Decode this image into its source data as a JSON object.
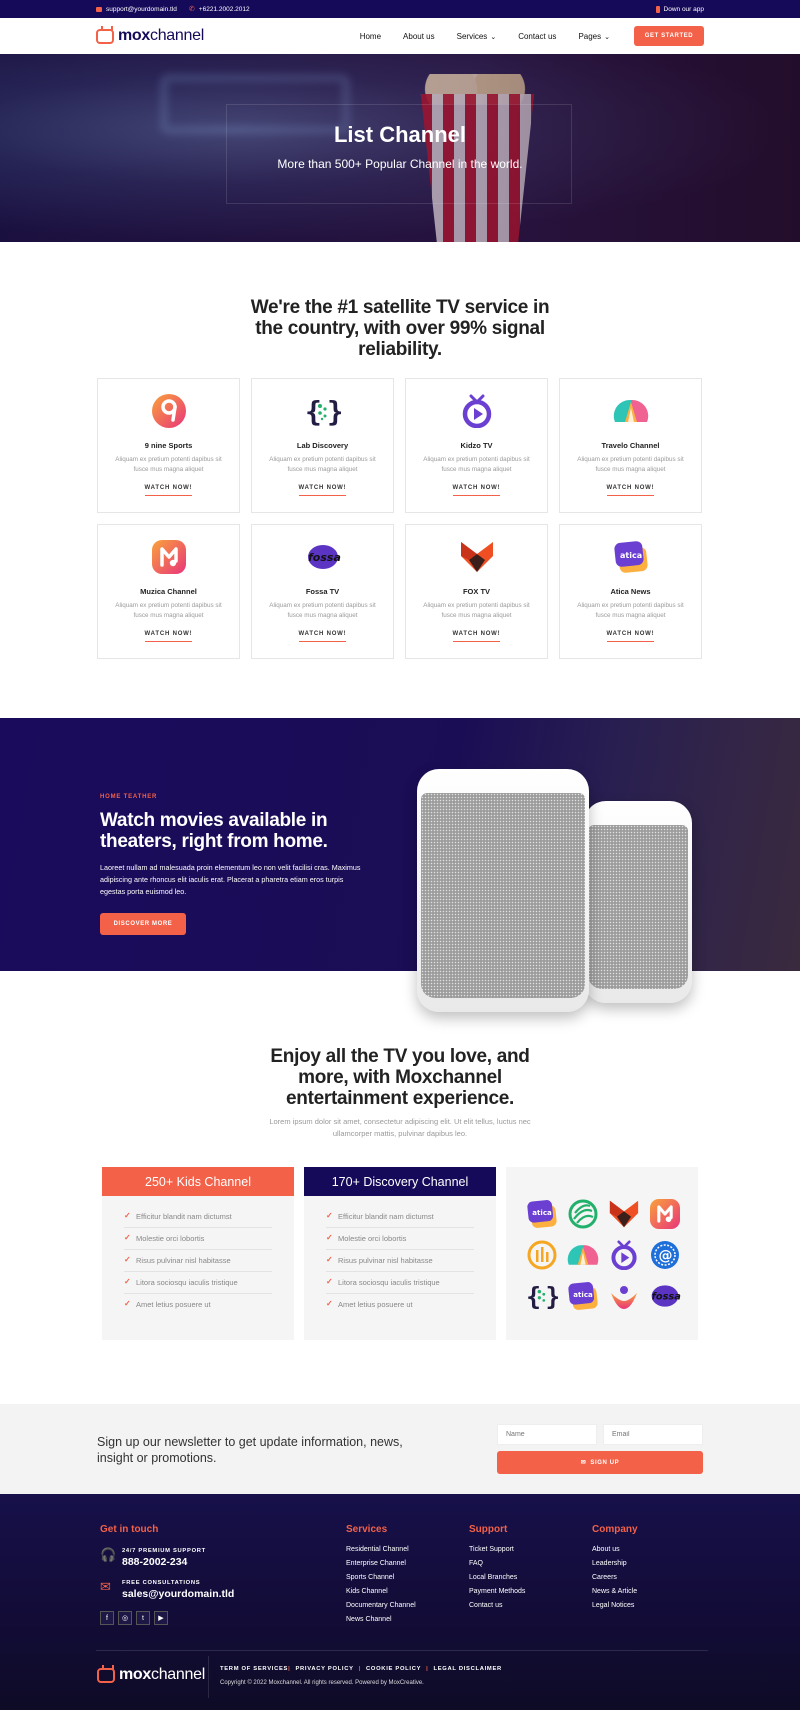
{
  "topbar": {
    "email": "support@yourdomain.tld",
    "phone": "+6221.2002.2012",
    "app_link": "Down our app"
  },
  "brand": {
    "name_bold": "mox",
    "name_regular": "channel"
  },
  "nav": {
    "items": [
      "Home",
      "About us",
      "Services",
      "Contact us",
      "Pages"
    ],
    "cta": "GET STARTED"
  },
  "hero": {
    "title": "List Channel",
    "subtitle": "More than 500+ Popular Channel in the world."
  },
  "channels_section": {
    "title": "We're the #1 satellite TV service in the country, with over 99% signal reliability.",
    "cards": [
      {
        "name": "9 nine Sports",
        "desc": "Aliquam ex pretium potenti dapibus sit fusce mus magna aliquet",
        "cta": "WATCH NOW!",
        "icon": "nine-sports-icon"
      },
      {
        "name": "Lab Discovery",
        "desc": "Aliquam ex pretium potenti dapibus sit fusce mus magna aliquet",
        "cta": "WATCH NOW!",
        "icon": "lab-discovery-icon"
      },
      {
        "name": "Kidzo TV",
        "desc": "Aliquam ex pretium potenti dapibus sit fusce mus magna aliquet",
        "cta": "WATCH NOW!",
        "icon": "kidzo-tv-icon"
      },
      {
        "name": "Travelo Channel",
        "desc": "Aliquam ex pretium potenti dapibus sit fusce mus magna aliquet",
        "cta": "WATCH NOW!",
        "icon": "travelo-icon"
      },
      {
        "name": "Muzica Channel",
        "desc": "Aliquam ex pretium potenti dapibus sit fusce mus magna aliquet",
        "cta": "WATCH NOW!",
        "icon": "muzica-icon"
      },
      {
        "name": "Fossa TV",
        "desc": "Aliquam ex pretium potenti dapibus sit fusce mus magna aliquet",
        "cta": "WATCH NOW!",
        "icon": "fossa-icon"
      },
      {
        "name": "FOX TV",
        "desc": "Aliquam ex pretium potenti dapibus sit fusce mus magna aliquet",
        "cta": "WATCH NOW!",
        "icon": "fox-icon"
      },
      {
        "name": "Atica News",
        "desc": "Aliquam ex pretium potenti dapibus sit fusce mus magna aliquet",
        "cta": "WATCH NOW!",
        "icon": "atica-icon"
      }
    ],
    "fossa_logo_text": "fossa",
    "atica_logo_text": "atica"
  },
  "theater": {
    "eyebrow": "HOME TEATHER",
    "title": "Watch movies available in theaters, right from home.",
    "body": "Laoreet nullam ad malesuada proin elementum leo non velit facilisi cras. Maximus adipiscing ante rhoncus elit iaculis erat. Placerat a pharetra etiam eros turpis egestas porta euismod leo.",
    "cta": "DISCOVER MORE"
  },
  "enjoy": {
    "title": "Enjoy all the TV you love, and more, with Moxchannel entertainment experience.",
    "subtitle": "Lorem ipsum dolor sit amet, consectetur adipiscing elit. Ut elit tellus, luctus nec ullamcorper mattis, pulvinar dapibus leo."
  },
  "plans": [
    {
      "title": "250+ Kids Channel",
      "color": "#f26148",
      "features": [
        "Efficitur blandit nam dictumst",
        "Molestie orci lobortis",
        "Risus pulvinar nisl habitasse",
        "Litora sociosqu iaculis tristique",
        "Amet letius posuere ut"
      ]
    },
    {
      "title": "170+ Discovery Channel",
      "color": "#15095a",
      "features": [
        "Efficitur blandit nam dictumst",
        "Molestie orci lobortis",
        "Risus pulvinar nisl habitasse",
        "Litora sociosqu iaculis tristique",
        "Amet letius posuere ut"
      ]
    }
  ],
  "newsletter": {
    "text": "Sign up our newsletter to get update information, news, insight or promotions.",
    "name_placeholder": "Name",
    "email_placeholder": "Email",
    "cta": "SIGN UP"
  },
  "footer": {
    "contact_title": "Get in touch",
    "support_label": "24/7 PREMIUM SUPPORT",
    "support_phone": "888-2002-234",
    "consult_label": "FREE CONSULTATIONS",
    "consult_email": "sales@yourdomain.tld",
    "columns": [
      {
        "title": "Services",
        "links": [
          "Residential Channel",
          "Enterprise Channel",
          "Sports Channel",
          "Kids Channel",
          "Documentary Channel",
          "News Channel"
        ]
      },
      {
        "title": "Support",
        "links": [
          "Ticket Support",
          "FAQ",
          "Local Branches",
          "Payment Methods",
          "Contact us"
        ]
      },
      {
        "title": "Company",
        "links": [
          "About us",
          "Leadership",
          "Careers",
          "News & Article",
          "Legal Notices"
        ]
      }
    ],
    "legal": [
      "TERM OF SERVICES",
      "PRIVACY POLICY",
      "COOKIE POLICY",
      "LEGAL DISCLAIMER"
    ],
    "copyright": "Copyright © 2022 Moxchannel. All rights reserved. Powered by MoxCreative."
  },
  "colors": {
    "accent": "#f26148",
    "navy": "#15095a"
  }
}
